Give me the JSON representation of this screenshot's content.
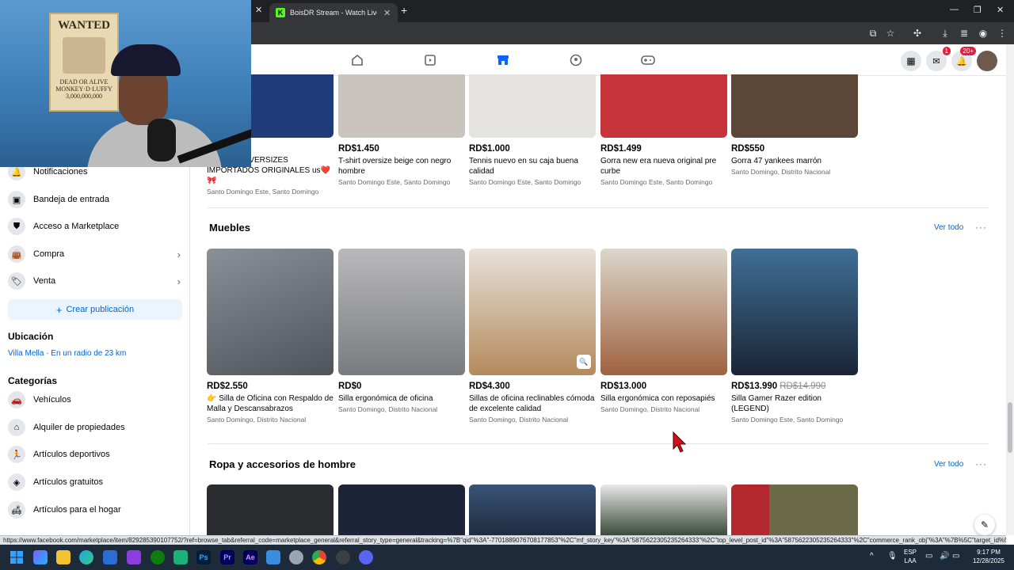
{
  "browser": {
    "active_tab_title": "BoisDR Stream - Watch Live on",
    "new_tab_symbol": "+",
    "status_url": "https://www.facebook.com/marketplace/item/829285390107752/?ref=browse_tab&referral_code=marketplace_general&referral_story_type=general&tracking=%7B\"qid\"%3A\"-7701889076708177853\"%2C\"mf_story_key\"%3A\"5875622305235264333\"%2C\"top_level_post_id\"%3A\"5875622305235264333\"%2C\"commerce_rank_obj\"%3A\"%7B%5C\"target_id%5C\"..."
  },
  "fb_nav": {
    "messenger_badge": "1",
    "notifications_badge": "20+"
  },
  "webcam": {
    "poster_title": "WANTED",
    "poster_line1": "DEAD OR ALIVE",
    "poster_line2": "MONKEY·D·LUFFY",
    "poster_bounty": "3,000,000,000"
  },
  "sidebar": {
    "items_top": [
      {
        "label": "Notificaciones",
        "icon": "bell-icon"
      },
      {
        "label": "Bandeja de entrada",
        "icon": "inbox-icon"
      },
      {
        "label": "Acceso a Marketplace",
        "icon": "shield-icon"
      },
      {
        "label": "Compra",
        "icon": "bag-icon"
      },
      {
        "label": "Venta",
        "icon": "tag-icon"
      }
    ],
    "create_label": "Crear publicación",
    "location_heading": "Ubicación",
    "location_value": "Villa Mella · En un radio de 23 km",
    "categories_heading": "Categorías",
    "categories": [
      {
        "label": "Vehículos",
        "icon": "car-icon"
      },
      {
        "label": "Alquiler de propiedades",
        "icon": "house-icon"
      },
      {
        "label": "Artículos deportivos",
        "icon": "runner-icon"
      },
      {
        "label": "Artículos gratuitos",
        "icon": "free-tag-icon"
      },
      {
        "label": "Artículos para el hogar",
        "icon": "home-goods-icon"
      }
    ]
  },
  "top_row": [
    {
      "price": "",
      "title": "...AMUZA OVERSIZES IMPORTADOS ORIGINALES us❤️🎀",
      "location": "Santo Domingo Este, Santo Domingo",
      "color": "#1f3b7a"
    },
    {
      "price": "RD$1.450",
      "title": "T-shirt oversize beige con negro hombre",
      "location": "Santo Domingo Este, Santo Domingo",
      "color": "#c9c4bd"
    },
    {
      "price": "RD$1.000",
      "title": "Tennis nuevo en su caja buena calidad",
      "location": "Santo Domingo Este, Santo Domingo",
      "color": "#e5e3e0"
    },
    {
      "price": "RD$1.499",
      "title": "Gorra new era nueva original pre curbe",
      "location": "Santo Domingo Este, Santo Domingo",
      "color": "#c7333a"
    },
    {
      "price": "RD$550",
      "title": "Gorra 47 yankees marrón",
      "location": "Santo Domingo, Distrito Nacional",
      "color": "#5b4637"
    }
  ],
  "sections": [
    {
      "title": "Muebles",
      "ver_todo": "Ver todo",
      "items": [
        {
          "price": "RD$2.550",
          "old_price": "",
          "title": "👉 Silla de Oficina con Respaldo de Malla y Descansabrazos Ajustable...",
          "location": "Santo Domingo, Distrito Nacional",
          "color": "#5d6168"
        },
        {
          "price": "RD$0",
          "old_price": "",
          "title": "Silla ergonómica de oficina",
          "location": "Santo Domingo, Distrito Nacional",
          "color": "#8a8b8f"
        },
        {
          "price": "RD$4.300",
          "old_price": "",
          "title": "Sillas de oficina reclinables cómoda de excelente calidad",
          "location": "Santo Domingo, Distrito Nacional",
          "color": "#b48a5c"
        },
        {
          "price": "RD$13.000",
          "old_price": "",
          "title": "Silla ergonómica con reposapiés",
          "location": "Santo Domingo, Distrito Nacional",
          "color": "#a0623f"
        },
        {
          "price": "RD$13.990",
          "old_price": "RD$14.990",
          "title": "Silla Gamer Razer edition (LEGEND)",
          "location": "Santo Domingo Este, Santo Domingo",
          "color": "#263a55"
        }
      ]
    },
    {
      "title": "Ropa y accesorios de hombre",
      "ver_todo": "Ver todo",
      "items": [
        {
          "color": "#2a2c30"
        },
        {
          "color": "#1d2438"
        },
        {
          "color": "#2a3d5c"
        },
        {
          "color": "#3b4a3a"
        },
        {
          "color": "#6b6a48"
        }
      ]
    }
  ],
  "taskbar": {
    "lang_line1": "ESP",
    "lang_line2": "LAA",
    "time": "9:17 PM",
    "date": "12/28/2025"
  },
  "colors": {
    "fb_blue": "#0866ff",
    "link_blue": "#0064d1"
  }
}
